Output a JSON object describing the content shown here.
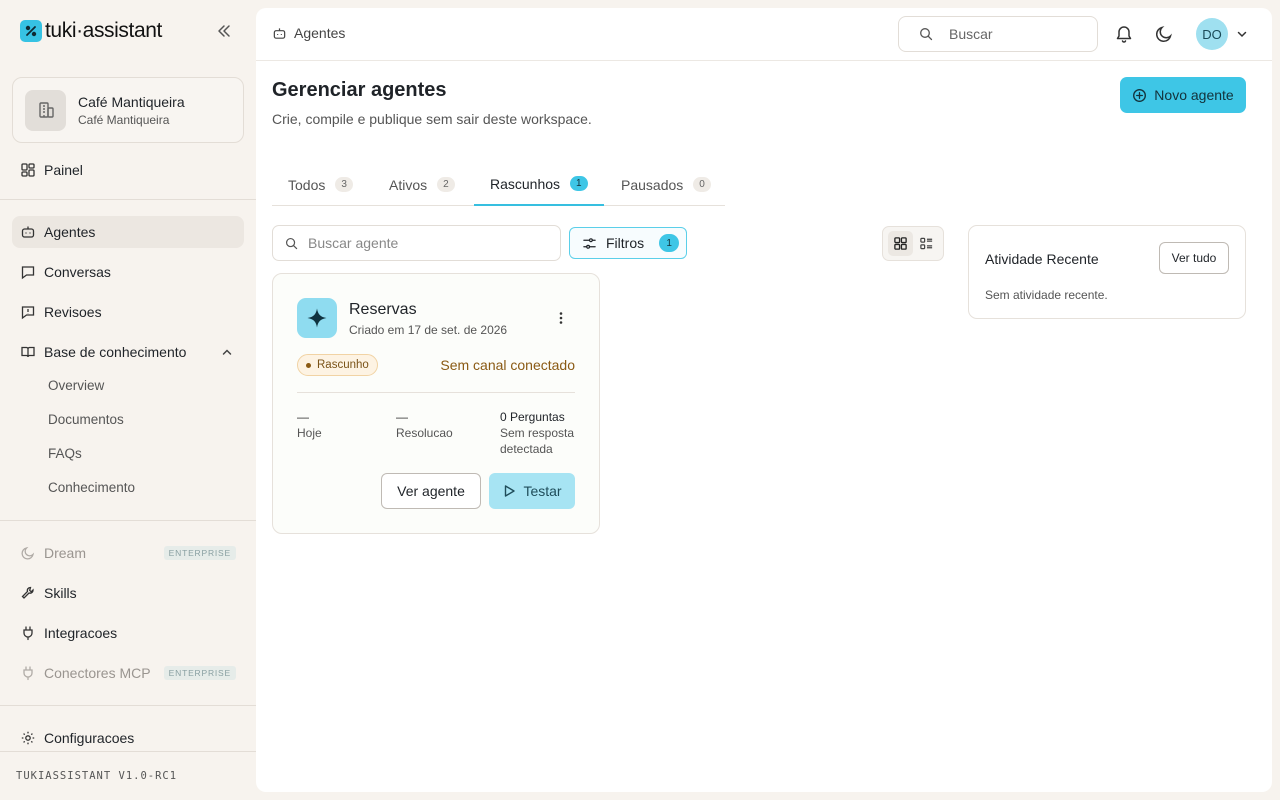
{
  "brand": {
    "name": "tuki·assistant"
  },
  "workspace": {
    "name": "Café Mantiqueira",
    "subtitle": "Café Mantiqueira"
  },
  "sidebar": {
    "painel": "Painel",
    "items": [
      {
        "label": "Agentes"
      },
      {
        "label": "Conversas"
      },
      {
        "label": "Revisoes"
      },
      {
        "label": "Base de conhecimento"
      }
    ],
    "knowledge_sub": [
      "Overview",
      "Documentos",
      "FAQs",
      "Conhecimento"
    ],
    "dream": {
      "label": "Dream",
      "badge": "ENTERPRISE"
    },
    "skills": "Skills",
    "integracoes": "Integracoes",
    "mcp": {
      "label": "Conectores MCP",
      "badge": "ENTERPRISE"
    },
    "config": "Configuracoes",
    "version": "TUKIASSISTANT V1.0-RC1"
  },
  "topbar": {
    "breadcrumb": "Agentes",
    "search_placeholder": "Buscar",
    "avatar_initials": "DO"
  },
  "page": {
    "title": "Gerenciar agentes",
    "subtitle": "Crie, compile e publique sem sair deste workspace.",
    "new_button": "Novo agente"
  },
  "tabs": [
    {
      "label": "Todos",
      "count": "3"
    },
    {
      "label": "Ativos",
      "count": "2"
    },
    {
      "label": "Rascunhos",
      "count": "1"
    },
    {
      "label": "Pausados",
      "count": "0"
    }
  ],
  "filters": {
    "search_placeholder": "Buscar agente",
    "filter_label": "Filtros",
    "filter_count": "1"
  },
  "agent": {
    "name": "Reservas",
    "created": "Criado em 17 de set. de 2026",
    "status": "Rascunho",
    "channel": "Sem canal conectado",
    "metrics": [
      {
        "value": "—",
        "label": "Hoje"
      },
      {
        "value": "—",
        "label": "Resolucao"
      },
      {
        "value": "0 Perguntas",
        "label": "Sem resposta",
        "label2": "detectada"
      }
    ],
    "view_button": "Ver agente",
    "test_button": "Testar"
  },
  "activity": {
    "title": "Atividade Recente",
    "view_all": "Ver tudo",
    "empty": "Sem atividade recente."
  },
  "colors": {
    "accent": "#3ec6e6",
    "draft_badge": "#fdf3e3",
    "draft_text": "#8a5a14"
  }
}
